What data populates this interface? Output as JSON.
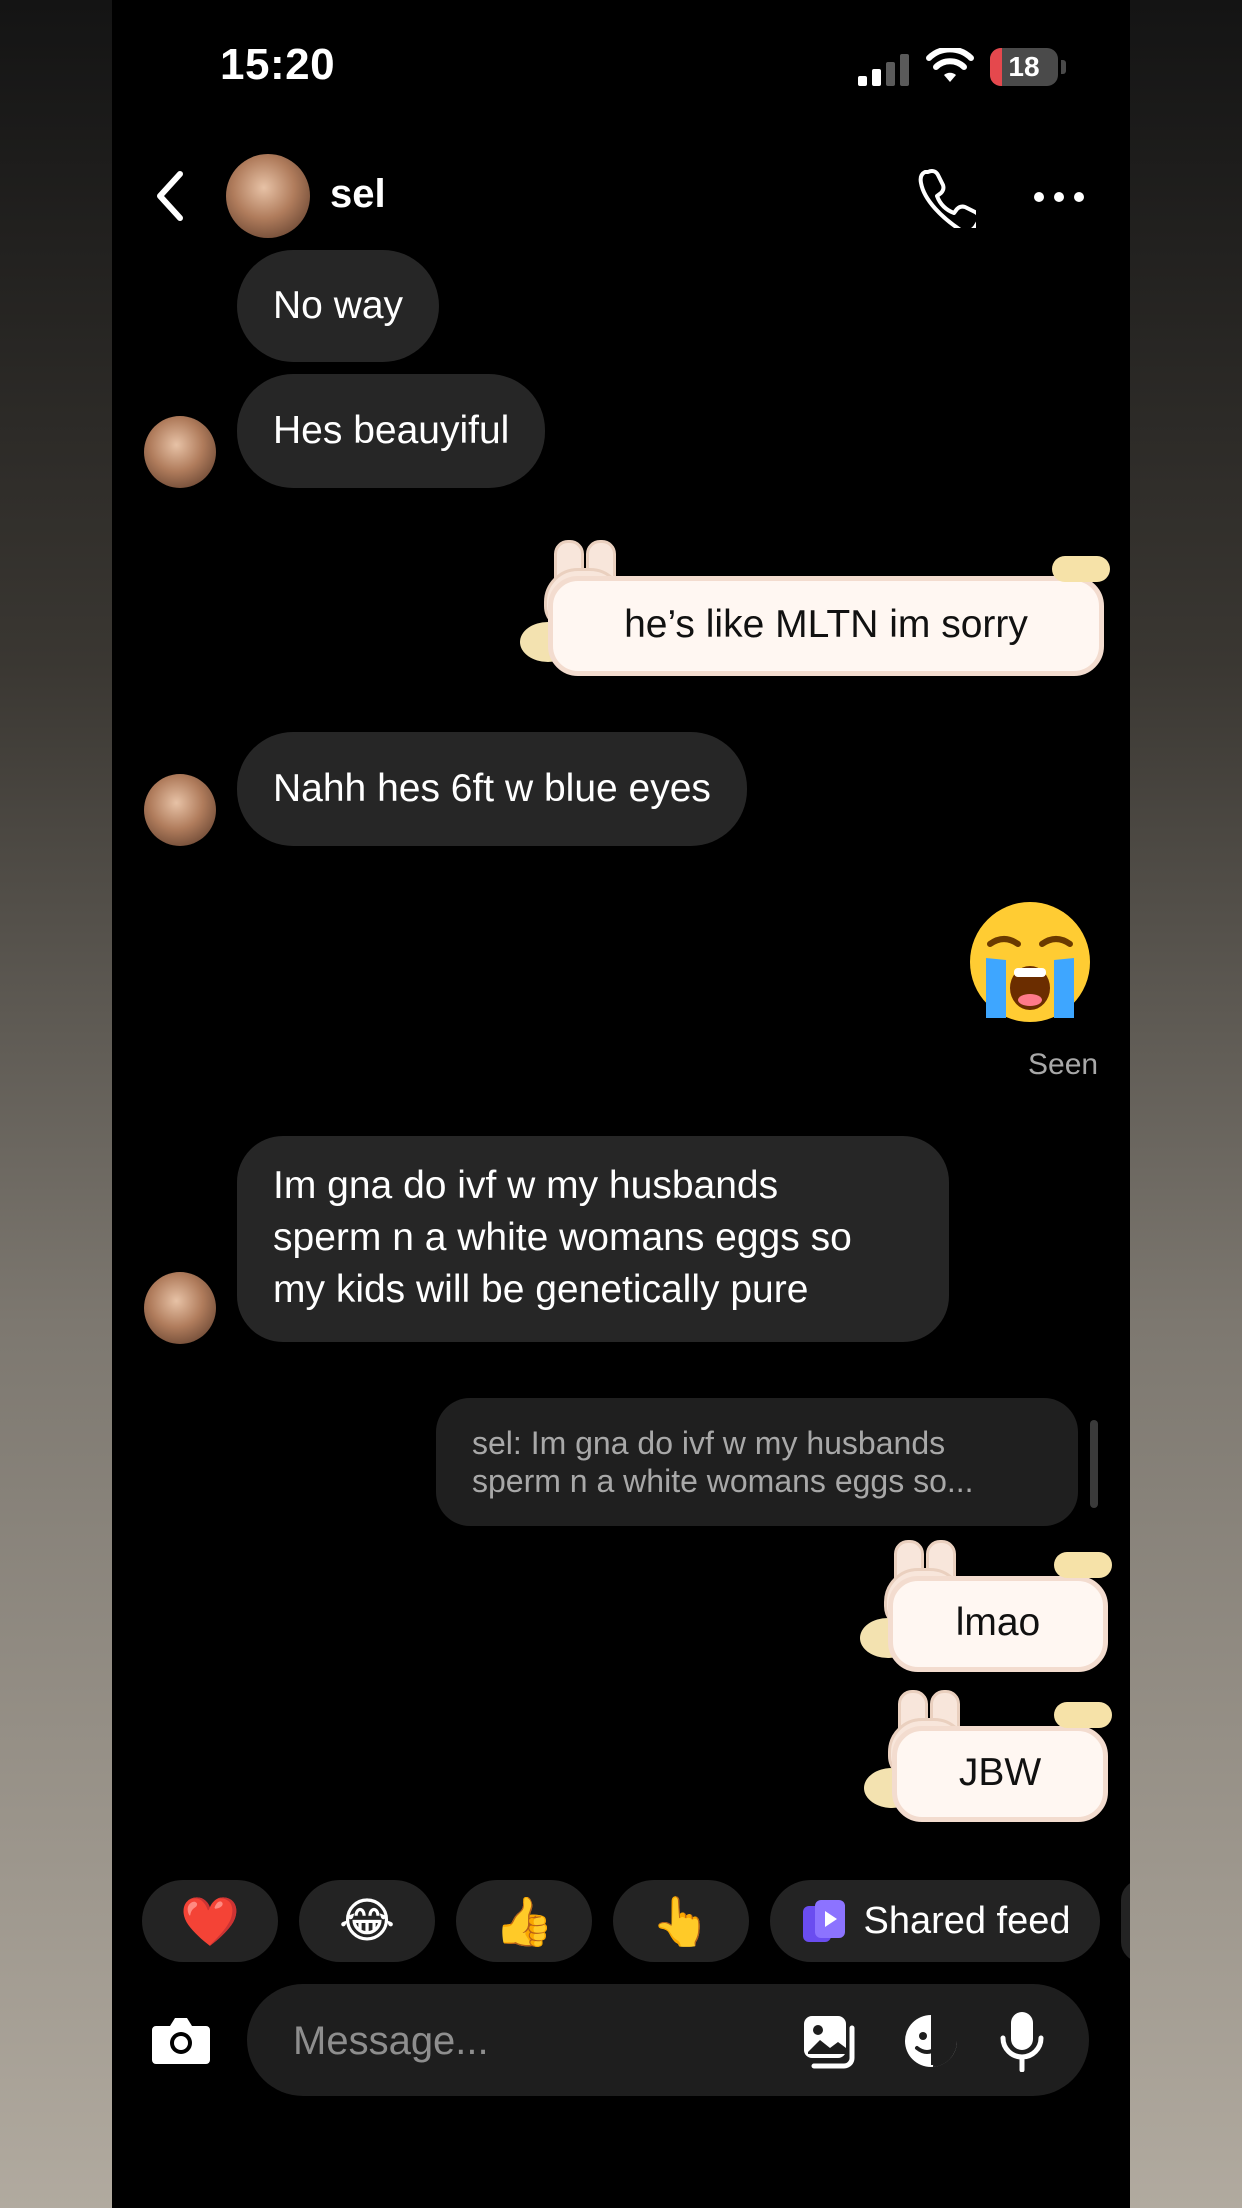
{
  "status": {
    "time": "15:20",
    "battery": "18",
    "battery_fraction": 0.18
  },
  "header": {
    "name": "sel"
  },
  "messages": [
    {
      "from": "sel",
      "text": "No way"
    },
    {
      "from": "sel",
      "text": "Hes beauyiful"
    },
    {
      "from": "me",
      "text": "he’s like MLTN im sorry"
    },
    {
      "from": "sel",
      "text": "Nahh hes 6ft w blue eyes"
    },
    {
      "from": "me",
      "text": "😭"
    },
    {
      "from": "sel",
      "lines": [
        "Im gna do ivf w my husbands",
        "sperm n a white womans eggs so",
        "my kids will be genetically pure"
      ]
    },
    {
      "from": "me",
      "text": "lmao"
    },
    {
      "from": "me",
      "text": "JBW"
    }
  ],
  "seen_label": "Seen",
  "reply": {
    "line1": "sel: Im gna do ivf w my husbands",
    "line2": "sperm n a white womans eggs so..."
  },
  "quick_reactions": [
    {
      "emoji": "❤️"
    },
    {
      "emoji": "😂"
    },
    {
      "emoji": "👍"
    },
    {
      "emoji": "👆"
    },
    {
      "label": "Shared feed"
    }
  ],
  "composer": {
    "placeholder": "Message..."
  },
  "colors": {
    "background": "#000000",
    "incoming_bubble": "#262626",
    "bunny_bubble": "#fff7f2",
    "accent_purple": "#7b5cff"
  }
}
